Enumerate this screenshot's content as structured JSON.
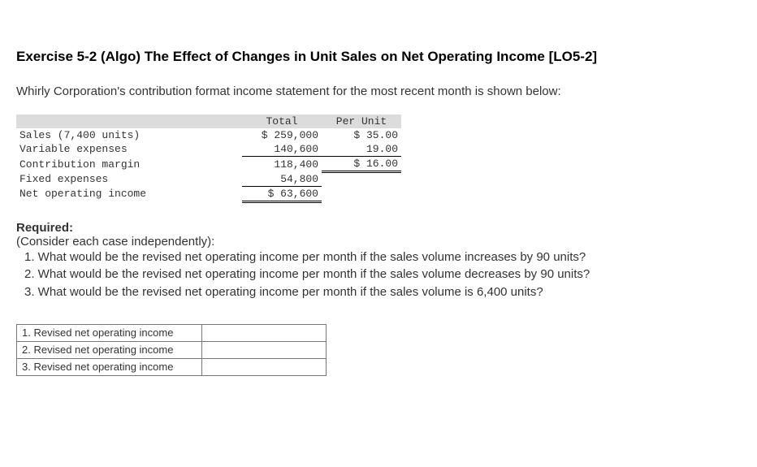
{
  "title": "Exercise 5-2 (Algo) The Effect of Changes in Unit Sales on Net Operating Income [LO5-2]",
  "intro": "Whirly Corporation's contribution format income statement for the most recent month is shown below:",
  "income": {
    "header_total": "Total",
    "header_per_unit": "Per Unit",
    "rows": {
      "sales_label": "Sales (7,400 units)",
      "sales_total": "$ 259,000",
      "sales_per_unit": "$ 35.00",
      "varexp_label": "Variable expenses",
      "varexp_total": "140,600",
      "varexp_per_unit": "19.00",
      "cm_label": "Contribution margin",
      "cm_total": "118,400",
      "cm_per_unit": "$ 16.00",
      "fixed_label": "Fixed expenses",
      "fixed_total": "54,800",
      "noi_label": "Net operating income",
      "noi_total": "$ 63,600"
    }
  },
  "required": {
    "heading": "Required:",
    "sub": "(Consider each case independently):",
    "q1": "1. What would be the revised net operating income per month if the sales volume increases by 90 units?",
    "q2": "2. What would be the revised net operating income per month if the sales volume decreases by 90 units?",
    "q3": "3. What would be the revised net operating income per month if the sales volume is 6,400 units?"
  },
  "answers": {
    "row1": "1. Revised net operating income",
    "row2": "2. Revised net operating income",
    "row3": "3. Revised net operating income",
    "val1": "",
    "val2": "",
    "val3": ""
  }
}
